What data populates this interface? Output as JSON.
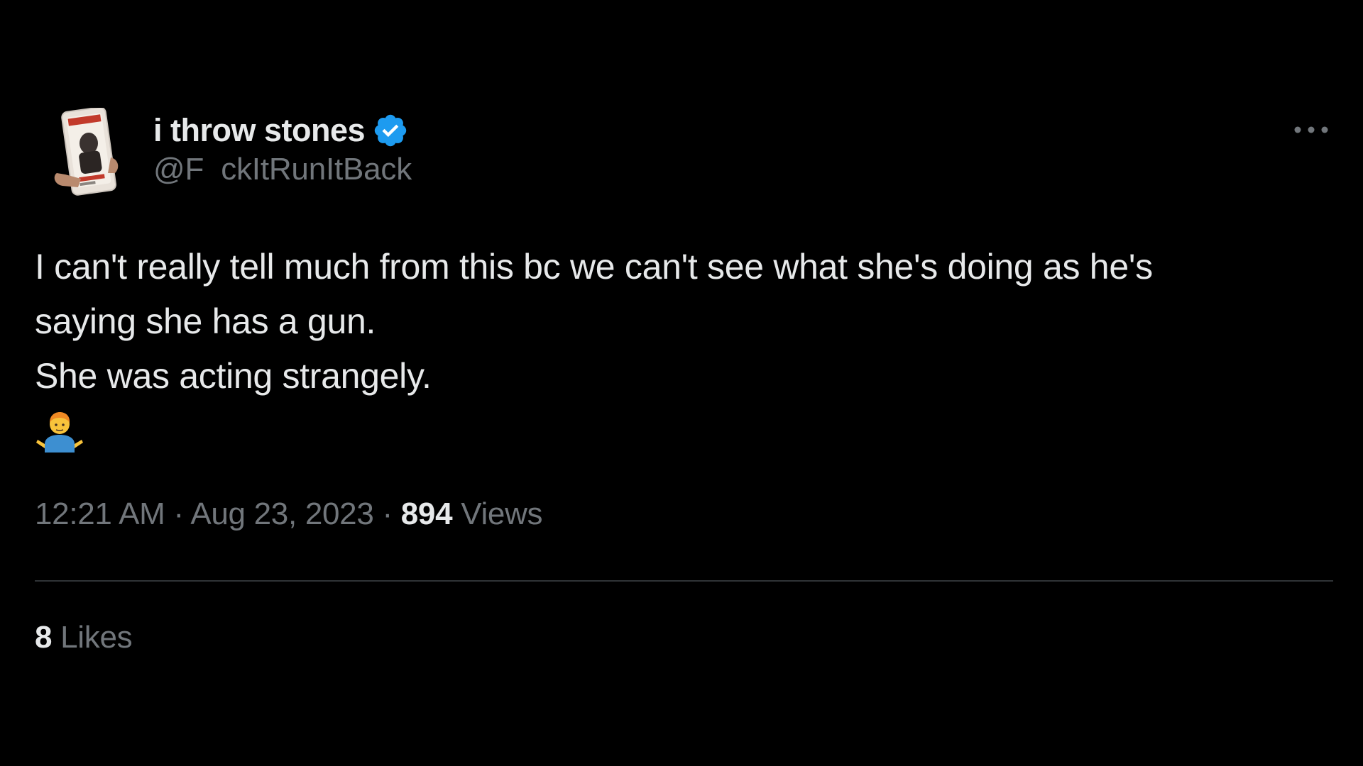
{
  "author": {
    "display_name": "i throw stones",
    "handle": "@F  ckItRunItBack",
    "verified_icon": "verified-badge-icon",
    "avatar_icon": "avatar-phone-magazine-image"
  },
  "tweet": {
    "lines": [
      "I can't really tell much from this bc we can't see what she's doing as he's",
      "saying she has a gun.",
      "She was acting strangely."
    ],
    "emoji": "man-shrugging-emoji"
  },
  "meta": {
    "time": "12:21 AM",
    "separator": "·",
    "date": "Aug 23, 2023",
    "views_count": "894",
    "views_label": "Views"
  },
  "stats": {
    "likes_count": "8",
    "likes_label": "Likes"
  },
  "colors": {
    "background": "#000000",
    "text_primary": "#e7e9ea",
    "text_secondary": "#71767b",
    "verified_blue": "#1d9bf0",
    "divider": "#2f3336"
  },
  "icons": {
    "more": "more-options-icon"
  }
}
